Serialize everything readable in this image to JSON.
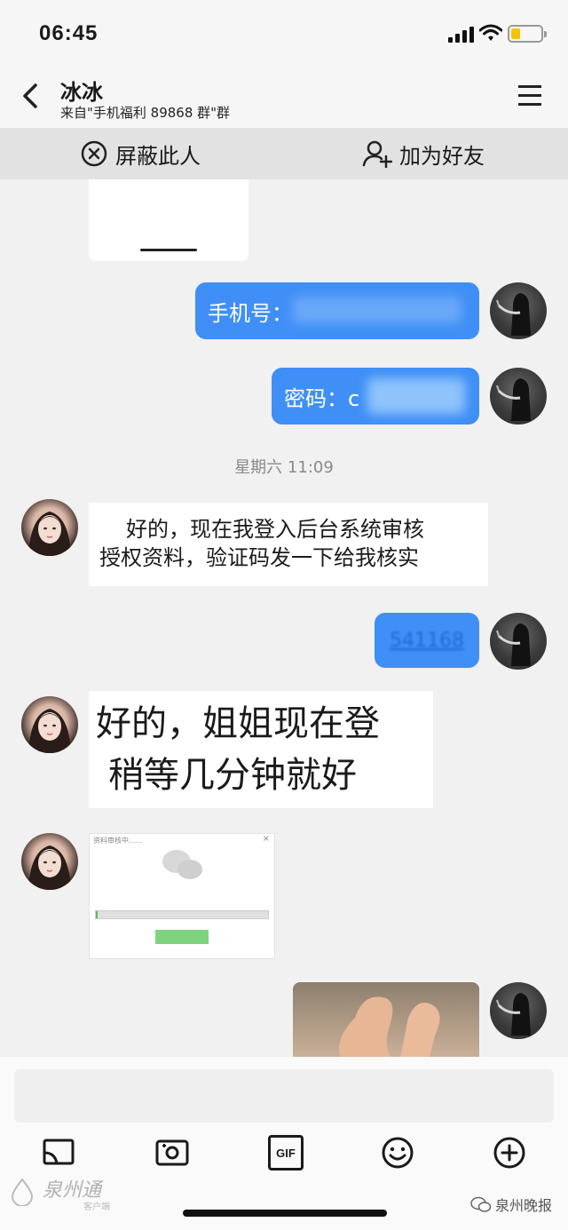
{
  "status_bar": {
    "time": "06:45"
  },
  "header": {
    "contact_name": "冰冰",
    "contact_subtitle": "来自\"手机福利 89868 群\"群"
  },
  "action_bar": {
    "block_label": "屏蔽此人",
    "add_friend_label": "加为好友"
  },
  "messages": {
    "phone_label": "手机号：",
    "password_label": "密码：c",
    "timestamp": "星期六 11:09",
    "reply_1_line1": "好的，现在我登入后台系统审核",
    "reply_1_line2": "授权资料，验证码发一下给我核实",
    "code_sent": "541168",
    "reply_2_line1": "好的，姐姐现在登",
    "reply_2_line2": "稍等几分钟就好",
    "dialog_title": "资料审核中......",
    "dialog_close": "×"
  },
  "toolbar": {
    "gif_label": "GIF"
  },
  "watermarks": {
    "left_line1": "泉州通",
    "left_line2": "客户端",
    "right": "泉州晚报"
  }
}
